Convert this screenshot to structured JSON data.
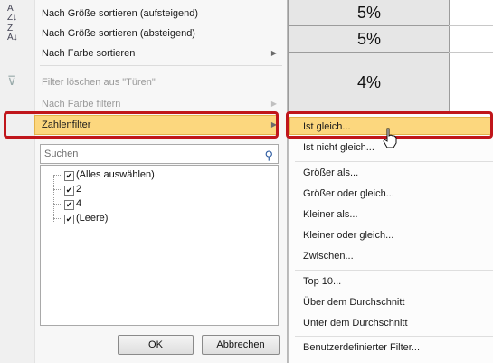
{
  "sheet": {
    "cells": [
      "5%",
      "5%",
      "4%"
    ]
  },
  "menu": {
    "items": [
      {
        "icon": "sort-ascending-icon",
        "label": "Nach Größe sortieren (aufsteigend)",
        "disabled": false
      },
      {
        "icon": "sort-descending-icon",
        "label": "Nach Größe sortieren (absteigend)",
        "disabled": false
      },
      {
        "label": "Nach Farbe sortieren",
        "disabled": false,
        "submenu": true
      },
      {
        "icon": "clear-filter-icon",
        "label": "Filter löschen aus \"Türen\"",
        "disabled": true
      },
      {
        "label": "Nach Farbe filtern",
        "disabled": true,
        "submenu": true
      },
      {
        "label": "Zahlenfilter",
        "disabled": false,
        "submenu": true,
        "highlighted": true
      }
    ],
    "search_placeholder": "Suchen",
    "tree": [
      {
        "label": "(Alles auswählen)",
        "checked": true
      },
      {
        "label": "2",
        "checked": true
      },
      {
        "label": "4",
        "checked": true
      },
      {
        "label": "(Leere)",
        "checked": true
      }
    ],
    "ok_label": "OK",
    "cancel_label": "Abbrechen"
  },
  "submenu": {
    "items": [
      {
        "label": "Ist gleich...",
        "highlighted": true
      },
      {
        "label": "Ist nicht gleich..."
      },
      {
        "label": "Größer als..."
      },
      {
        "label": "Größer oder gleich..."
      },
      {
        "label": "Kleiner als..."
      },
      {
        "label": "Kleiner oder gleich..."
      },
      {
        "label": "Zwischen..."
      },
      {
        "label": "Top 10..."
      },
      {
        "label": "Über dem Durchschnitt"
      },
      {
        "label": "Unter dem Durchschnitt"
      },
      {
        "label": "Benutzerdefinierter Filter..."
      }
    ]
  },
  "colors": {
    "highlight": "#fcd77e",
    "annotation_red": "#c0161b"
  }
}
